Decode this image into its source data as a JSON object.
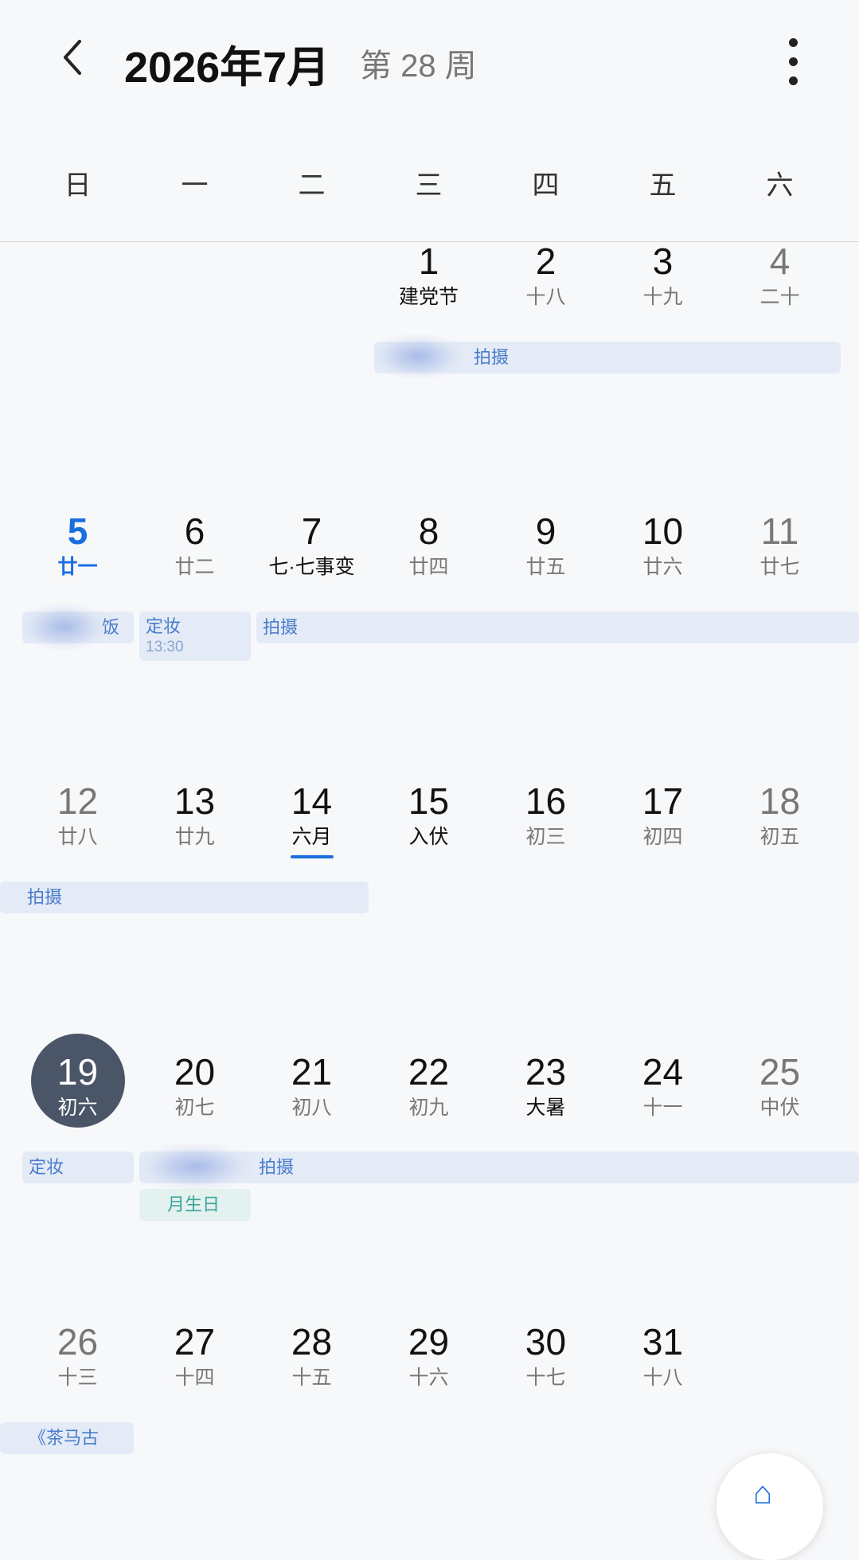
{
  "header": {
    "title": "2026年7月",
    "week": "第 28 周"
  },
  "weekdays": [
    "日",
    "一",
    "二",
    "三",
    "四",
    "五",
    "六"
  ],
  "days": [
    {
      "num": "1",
      "lunar": "建党节"
    },
    {
      "num": "2",
      "lunar": "十八"
    },
    {
      "num": "3",
      "lunar": "十九"
    },
    {
      "num": "4",
      "lunar": "二十"
    },
    {
      "num": "5",
      "lunar": "廿一"
    },
    {
      "num": "6",
      "lunar": "廿二"
    },
    {
      "num": "7",
      "lunar": "七·七事变"
    },
    {
      "num": "8",
      "lunar": "廿四"
    },
    {
      "num": "9",
      "lunar": "廿五"
    },
    {
      "num": "10",
      "lunar": "廿六"
    },
    {
      "num": "11",
      "lunar": "廿七"
    },
    {
      "num": "12",
      "lunar": "廿八"
    },
    {
      "num": "13",
      "lunar": "廿九"
    },
    {
      "num": "14",
      "lunar": "六月"
    },
    {
      "num": "15",
      "lunar": "入伏"
    },
    {
      "num": "16",
      "lunar": "初三"
    },
    {
      "num": "17",
      "lunar": "初四"
    },
    {
      "num": "18",
      "lunar": "初五"
    },
    {
      "num": "19",
      "lunar": "初六"
    },
    {
      "num": "20",
      "lunar": "初七"
    },
    {
      "num": "21",
      "lunar": "初八"
    },
    {
      "num": "22",
      "lunar": "初九"
    },
    {
      "num": "23",
      "lunar": "大暑"
    },
    {
      "num": "24",
      "lunar": "十一"
    },
    {
      "num": "25",
      "lunar": "中伏"
    },
    {
      "num": "26",
      "lunar": "十三"
    },
    {
      "num": "27",
      "lunar": "十四"
    },
    {
      "num": "28",
      "lunar": "十五"
    },
    {
      "num": "29",
      "lunar": "十六"
    },
    {
      "num": "30",
      "lunar": "十七"
    },
    {
      "num": "31",
      "lunar": "十八"
    }
  ],
  "events": {
    "shoot": "拍摄",
    "makeup": "定妆",
    "makeup_time": "13:30",
    "partial_fan": "饭",
    "birthday": "月生日",
    "tea": "《茶马古"
  },
  "fab": {
    "icon": "add-icon"
  },
  "colors": {
    "accent": "#1a6fe0",
    "selected": "#4a5568",
    "event_bg": "#e4ebf7",
    "event_text": "#4a7ccc"
  }
}
